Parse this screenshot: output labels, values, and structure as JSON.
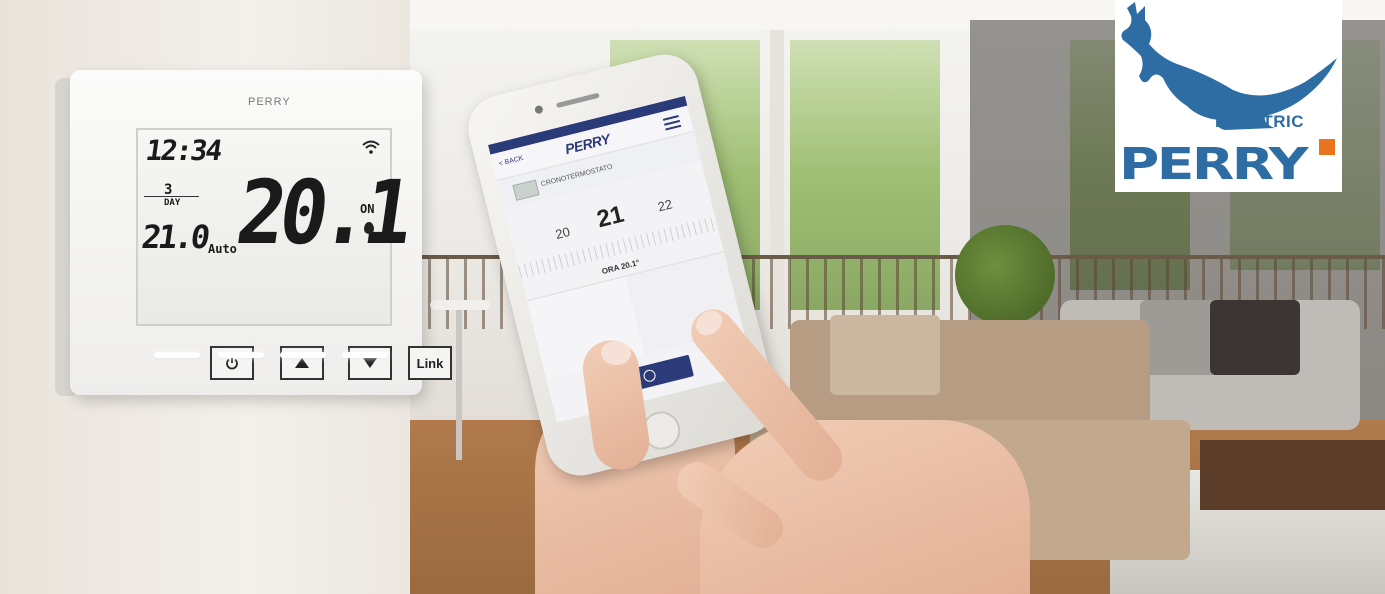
{
  "thermostat": {
    "brand": "PERRY",
    "time": "12:34",
    "day_number": "3",
    "day_label": "DAY",
    "set_temp": "21.0",
    "mode": "Auto",
    "current_temp": "20.1",
    "status": "ON",
    "buttons": {
      "link": "Link"
    },
    "icons": [
      "wifi-icon",
      "power-icon",
      "arrow-up-icon",
      "arrow-down-icon",
      "flame-icon"
    ]
  },
  "phone": {
    "nav_back": "< BACK",
    "app_logo": "PERRY",
    "device_name": "CRONOTERMOSTATO",
    "temp_prev": "20",
    "temp_current": "21",
    "temp_next": "22",
    "ora_label": "ORA 20.1°"
  },
  "logo": {
    "tagline": "ELECTRIC",
    "brand": "PERRY",
    "colors": {
      "blue": "#2e6da4",
      "orange": "#e9731f"
    }
  }
}
